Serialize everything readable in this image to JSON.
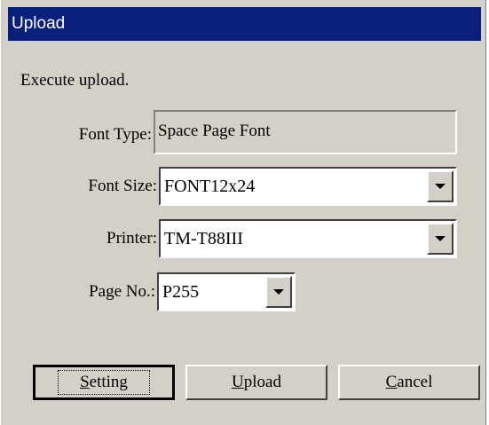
{
  "window": {
    "title": "Upload"
  },
  "message": "Execute upload.",
  "fields": {
    "font_type": {
      "label": "Font Type:",
      "value": "Space Page Font"
    },
    "font_size": {
      "label": "Font Size:",
      "value": "FONT12x24"
    },
    "printer": {
      "label": "Printer:",
      "value": "TM-T88III"
    },
    "page_no": {
      "label": "Page No.:",
      "value": "P255"
    }
  },
  "buttons": {
    "setting": {
      "mnemonic": "S",
      "rest": "etting"
    },
    "upload": {
      "mnemonic": "U",
      "rest": "pload"
    },
    "cancel": {
      "mnemonic": "C",
      "rest": "ancel"
    }
  },
  "icons": {
    "dropdown": "chevron-down-icon"
  },
  "colors": {
    "titlebar": "#0a1f7a",
    "face": "#d4d0c8"
  }
}
